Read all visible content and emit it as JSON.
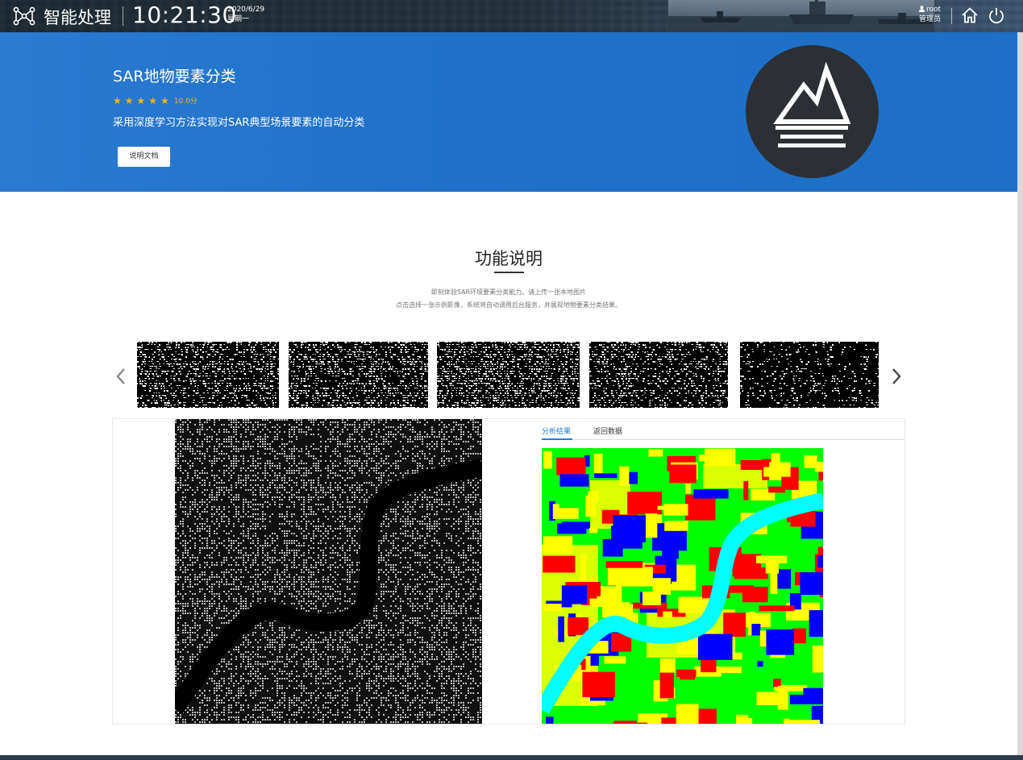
{
  "topbar": {
    "app_title": "智能处理",
    "time": "10:21:30",
    "date": "2020/6/29",
    "weekday": "星期一",
    "user_name": "root",
    "user_role": "管理员",
    "icons": [
      "network-logo-icon",
      "user-icon",
      "home-icon",
      "power-icon"
    ]
  },
  "banner": {
    "title": "SAR地物要素分类",
    "rating_stars": 5,
    "score": "10.0分",
    "description": "采用深度学习方法实现对SAR典型场景要素的自动分类",
    "doc_button": "说明文档",
    "emblem_icon": "mountain-water-icon"
  },
  "section": {
    "title": "功能说明",
    "line1": "即刻体验SAR环境要素分类能力。请上传一张本地图片",
    "line2": "点击选择一张示例影像，系统将自动调用后台服务，并展现地物要素分类结果。"
  },
  "carousel": {
    "prev_icon": "chevron-left-icon",
    "next_icon": "chevron-right-icon",
    "thumbnail_count": 5
  },
  "result": {
    "tabs": [
      "分析结果",
      "返回数据"
    ],
    "active_tab": 0
  },
  "colors": {
    "banner_blue": "#2a7ad0",
    "accent": "#1f80d8",
    "star": "#f5b51d",
    "class_vegetation": "#00ff00",
    "class_water": "#00ffff",
    "class_building": "#0000ff",
    "class_bare": "#ffff00",
    "class_other": "#ff0000"
  }
}
